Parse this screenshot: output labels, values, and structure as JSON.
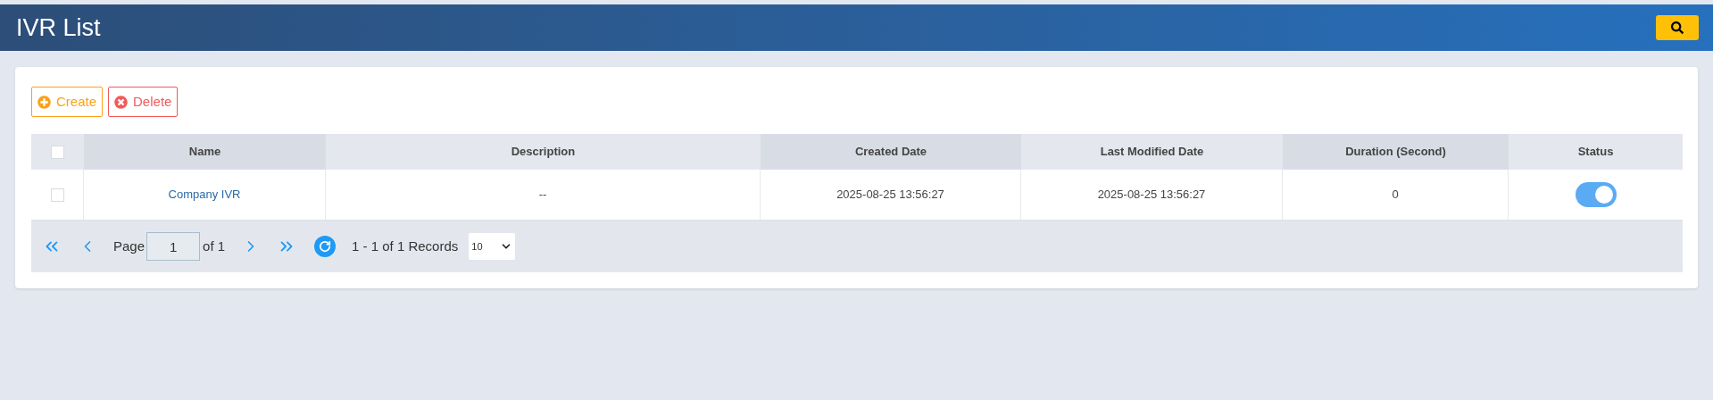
{
  "header": {
    "title": "IVR List"
  },
  "toolbar": [
    {
      "kind": "create",
      "label": "Create"
    },
    {
      "kind": "delete",
      "label": "Delete"
    }
  ],
  "table": {
    "select_all": {
      "checked": false
    },
    "columns": [
      "Name",
      "Description",
      "Created Date",
      "Last Modified Date",
      "Duration (Second)",
      "Status"
    ],
    "rows": [
      {
        "checked": false,
        "name": "Company IVR",
        "description": "--",
        "created": "2025-08-25 13:56:27",
        "modified": "2025-08-25 13:56:27",
        "duration": "0",
        "status_on": true
      }
    ]
  },
  "pager": {
    "page_label": "Page",
    "page": "1",
    "of": "of 1",
    "records": "1 - 1 of 1 Records",
    "page_size": "10"
  }
}
